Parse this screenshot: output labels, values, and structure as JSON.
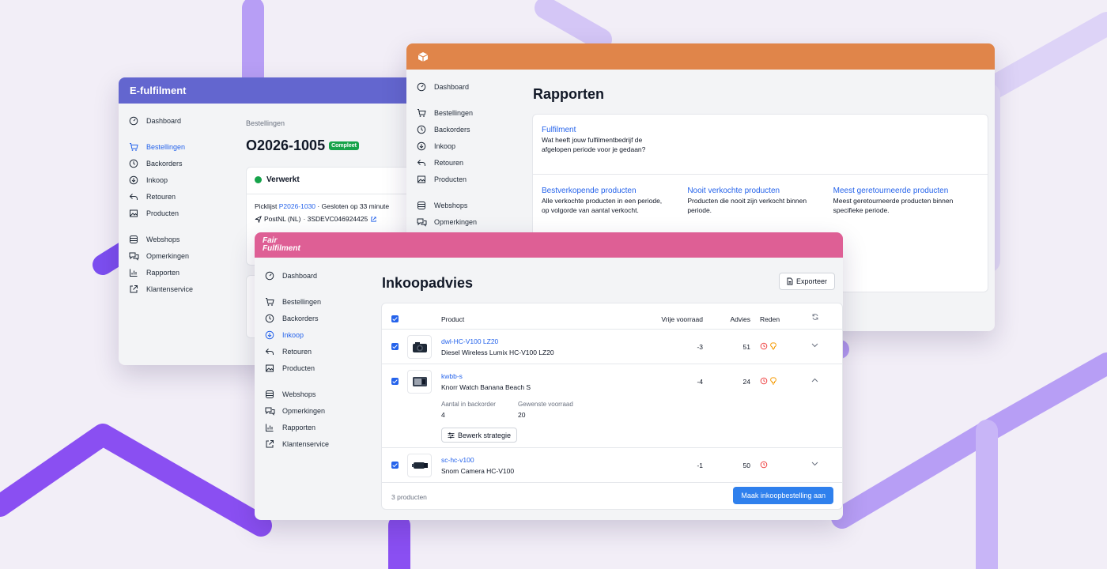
{
  "colors": {
    "indigo": "#6366cf",
    "orange": "#e0854a",
    "pink": "#de5f95",
    "link": "#2563eb",
    "success": "#16a34a",
    "background": "#f2eef7"
  },
  "w1": {
    "title": "E-fulfilment",
    "nav": [
      {
        "label": "Dashboard",
        "icon": "dashboard-icon"
      },
      {
        "label": "Bestellingen",
        "icon": "cart-icon",
        "active": true
      },
      {
        "label": "Backorders",
        "icon": "clock-icon"
      },
      {
        "label": "Inkoop",
        "icon": "download-circle-icon"
      },
      {
        "label": "Retouren",
        "icon": "return-arrow-icon"
      },
      {
        "label": "Producten",
        "icon": "image-icon"
      },
      {
        "label": "Webshops",
        "icon": "database-icon"
      },
      {
        "label": "Opmerkingen",
        "icon": "chat-icon"
      },
      {
        "label": "Rapporten",
        "icon": "bar-chart-icon"
      },
      {
        "label": "Klantenservice",
        "icon": "external-link-icon"
      }
    ],
    "breadcrumb": "Bestellingen",
    "order_title": "O2026-1005",
    "badge": "Compleet",
    "status": "Verwerkt",
    "picklist_label": "Picklijst",
    "picklist_link": "P2026-1030",
    "closed_text": "· Gesloten op 33 minute",
    "carrier": "PostNL (NL)",
    "tracking": "· 3SDEVC046924425"
  },
  "w2": {
    "nav": [
      {
        "label": "Dashboard",
        "icon": "dashboard-icon"
      },
      {
        "label": "Bestellingen",
        "icon": "cart-icon"
      },
      {
        "label": "Backorders",
        "icon": "clock-icon"
      },
      {
        "label": "Inkoop",
        "icon": "download-circle-icon"
      },
      {
        "label": "Retouren",
        "icon": "return-arrow-icon"
      },
      {
        "label": "Producten",
        "icon": "image-icon"
      },
      {
        "label": "Webshops",
        "icon": "database-icon"
      },
      {
        "label": "Opmerkingen",
        "icon": "chat-icon"
      }
    ],
    "page_title": "Rapporten",
    "featured": {
      "title": "Fulfilment",
      "desc1": "Wat heeft jouw fulfilmentbedrijf de",
      "desc2": "afgelopen periode voor je gedaan?"
    },
    "reports": [
      {
        "title": "Bestverkopende producten",
        "desc1": "Alle verkochte producten in een periode,",
        "desc2": "op volgorde van aantal verkocht."
      },
      {
        "title": "Nooit verkochte producten",
        "desc1": "Producten die nooit zijn verkocht binnen",
        "desc2": "periode."
      },
      {
        "title": "Meest geretourneerde producten",
        "desc1": "Meest geretourneerde producten binnen",
        "desc2": "specifieke periode."
      }
    ]
  },
  "w3": {
    "logo_line1": "Fair",
    "logo_line2": "Fulfilment",
    "nav": [
      {
        "label": "Dashboard",
        "icon": "dashboard-icon"
      },
      {
        "label": "Bestellingen",
        "icon": "cart-icon"
      },
      {
        "label": "Backorders",
        "icon": "clock-icon"
      },
      {
        "label": "Inkoop",
        "icon": "download-circle-icon",
        "active": true
      },
      {
        "label": "Retouren",
        "icon": "return-arrow-icon"
      },
      {
        "label": "Producten",
        "icon": "image-icon"
      },
      {
        "label": "Webshops",
        "icon": "database-icon"
      },
      {
        "label": "Opmerkingen",
        "icon": "chat-icon"
      },
      {
        "label": "Rapporten",
        "icon": "bar-chart-icon"
      },
      {
        "label": "Klantenservice",
        "icon": "external-link-icon"
      }
    ],
    "page_title": "Inkoopadvies",
    "export_label": "Exporteer",
    "columns": {
      "product": "Product",
      "stock": "Vrije voorraad",
      "advice": "Advies",
      "reason": "Reden"
    },
    "rows": [
      {
        "sku": "dwl-HC-V100 LZ20",
        "name": "Diesel Wireless Lumix HC-V100 LZ20",
        "stock": "-3",
        "advice": "51",
        "reasons": [
          "clock",
          "lightbulb"
        ],
        "expanded": false
      },
      {
        "sku": "kwbb-s",
        "name": "Knorr Watch Banana Beach S",
        "stock": "-4",
        "advice": "24",
        "reasons": [
          "clock",
          "lightbulb"
        ],
        "expanded": true
      },
      {
        "sku": "sc-hc-v100",
        "name": "Snom Camera HC-V100",
        "stock": "-1",
        "advice": "50",
        "reasons": [
          "clock"
        ],
        "expanded": false
      }
    ],
    "detail": {
      "backorder_label": "Aantal in backorder",
      "backorder_value": "4",
      "desired_label": "Gewenste voorraad",
      "desired_value": "20",
      "strategy_button": "Bewerk strategie"
    },
    "footer_count": "3 producten",
    "primary_button": "Maak inkoopbestelling aan"
  }
}
